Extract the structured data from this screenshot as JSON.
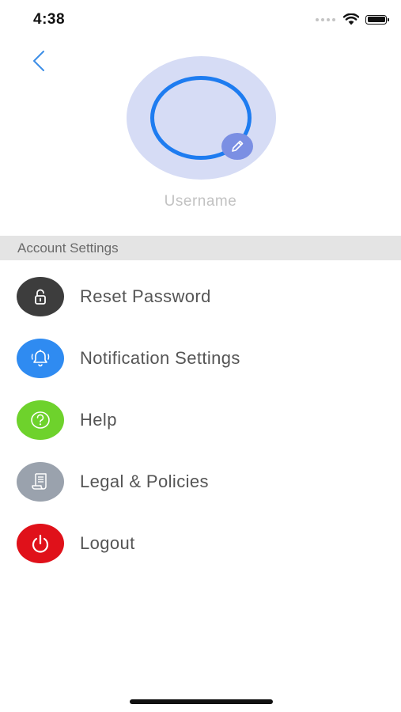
{
  "status_bar": {
    "time": "4:38"
  },
  "profile": {
    "username": "Username"
  },
  "section": {
    "title": "Account Settings"
  },
  "menu": [
    {
      "label": "Reset Password",
      "icon": "unlock-icon",
      "color": "#3d3d3d"
    },
    {
      "label": "Notification Settings",
      "icon": "bell-icon",
      "color": "#2f8bf1"
    },
    {
      "label": "Help",
      "icon": "question-icon",
      "color": "#6ed22c"
    },
    {
      "label": "Legal & Policies",
      "icon": "document-icon",
      "color": "#9aa2ad"
    },
    {
      "label": "Logout",
      "icon": "power-icon",
      "color": "#e0111a"
    }
  ],
  "colors": {
    "accent": "#1e7cf0",
    "avatar_bg": "#d6dcf5",
    "edit_badge": "#7b8fe3",
    "section_bg": "#e4e4e4"
  }
}
